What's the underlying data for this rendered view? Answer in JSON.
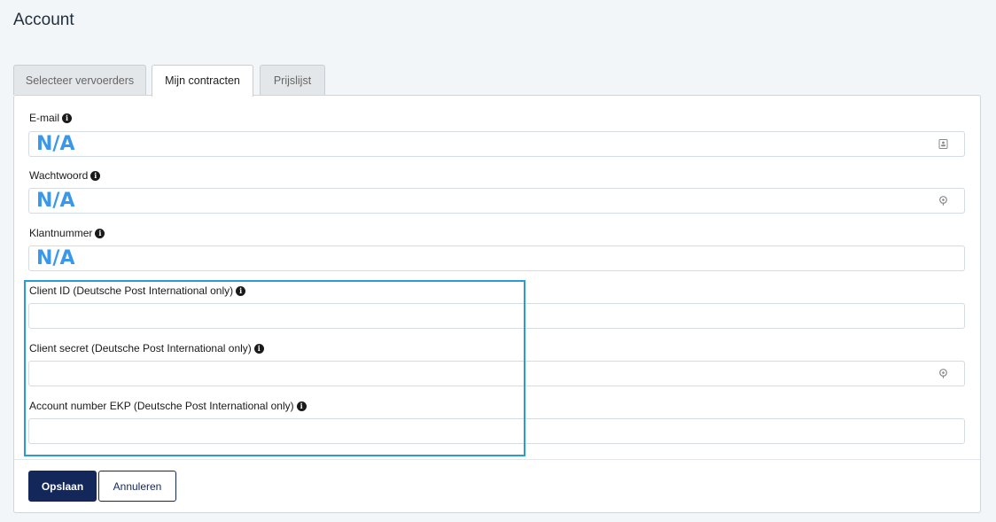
{
  "page": {
    "title": "Account"
  },
  "tabs": [
    {
      "label": "Selecteer vervoerders",
      "active": false
    },
    {
      "label": "Mijn contracten",
      "active": true
    },
    {
      "label": "Prijslijst",
      "active": false
    }
  ],
  "fields": {
    "email": {
      "label": "E-mail",
      "value": "N/A",
      "icon": "contact-card-icon"
    },
    "password": {
      "label": "Wachtwoord",
      "value": "N/A",
      "icon": "key-icon"
    },
    "customer_number": {
      "label": "Klantnummer",
      "value": "N/A"
    },
    "client_id": {
      "label": "Client ID (Deutsche Post International only)",
      "value": ""
    },
    "client_secret": {
      "label": "Client secret (Deutsche Post International only)",
      "value": "",
      "icon": "key-icon"
    },
    "account_number": {
      "label": "Account number EKP (Deutsche Post International only)",
      "value": ""
    }
  },
  "buttons": {
    "save": "Opslaan",
    "cancel": "Annuleren"
  },
  "colors": {
    "value_text": "#3a98ea",
    "primary": "#14275a",
    "highlight": "#2b9bd8"
  }
}
